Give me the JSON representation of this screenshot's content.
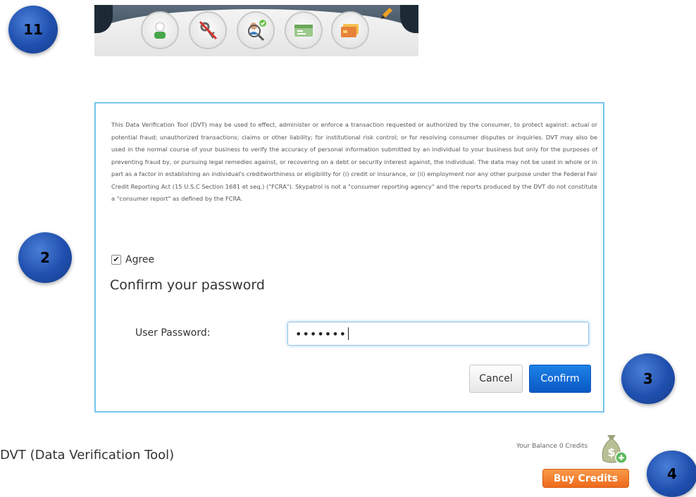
{
  "steps": {
    "step_top": "11",
    "step_dialog": "2",
    "step_confirm": "3",
    "step_buy": "4"
  },
  "toolbar": {
    "icons": [
      "user-icon",
      "key-disabled-icon",
      "verify-user-icon",
      "id-card-icon",
      "credit-card-icon",
      "pencil-icon"
    ]
  },
  "dialog": {
    "legal_text": "This Data Verification Tool (DVT) may be used to effect, administer or enforce a transaction requested or authorized by the consumer, to protect against: actual or potential fraud; unauthorized transactions; claims or other liability; for institutional risk control; or for resolving consumer disputes or inquiries. DVT may also be used in the normal course of your business to verify the accuracy of personal information submitted by an individual to your business but only for the purposes of preventing fraud by, or pursuing legal remedies against, or recovering on a debt or security interest against, the individual. The data may not be used in whole or in part as a factor in establishing an individual's creditworthiness or eligibility for (i) credit or insurance, or (ii) employment nor any other purpose under the Federal Fair Credit Reporting Act (15 U.S.C Section 1681 et seq.) (\"FCRA\"). Skypatrol is not a \"consumer reporting agency\" and the reports produced by the DVT do not constitute a \"consumer report\" as defined by the FCRA.",
    "agree_label": "Agree",
    "agree_checked": true,
    "confirm_heading": "Confirm your password",
    "password_label": "User Password:",
    "password_value": "•••••••",
    "cancel_label": "Cancel",
    "confirm_label": "Confirm"
  },
  "footer": {
    "page_title": "DVT (Data Verification Tool)",
    "balance_text": "Your Balance 0 Credits",
    "buy_credits_label": "Buy Credits"
  },
  "colors": {
    "dialog_border": "#74c6ec",
    "confirm_blue": "#0a58c4",
    "buy_orange": "#ee6a1c",
    "step_blue": "#1f4fae"
  }
}
